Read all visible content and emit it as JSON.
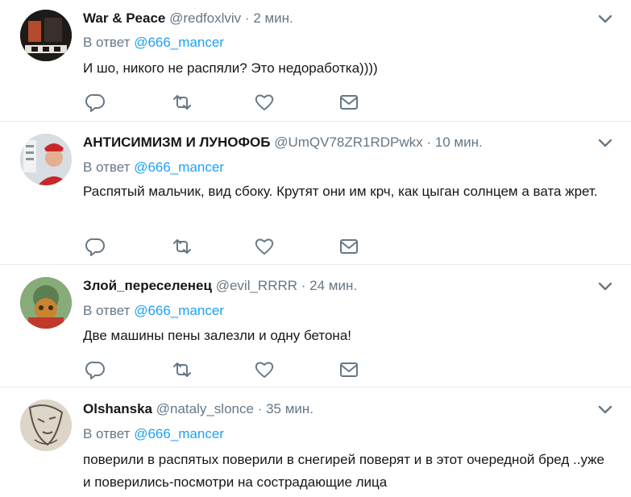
{
  "colors": {
    "text": "#14171a",
    "secondary": "#657786",
    "link": "#1da1f2",
    "divider": "#e6ecf0"
  },
  "icons": [
    "chevron-down-icon",
    "reply-icon",
    "retweet-icon",
    "like-icon",
    "direct-message-icon"
  ],
  "tweets": [
    {
      "name": "War & Peace",
      "handle": "@redfoxlviv",
      "sep": "·",
      "time": "2 мин.",
      "reply_prefix": "В ответ",
      "reply_mention": "@666_mancer",
      "text": "И шо, никого не распяли? Это недоработка))))"
    },
    {
      "name": "АНТИСИМИЗМ И ЛУНОФОБ",
      "handle": "@UmQV78ZR1RDPwkx",
      "sep": "·",
      "time": "10 мин.",
      "reply_prefix": "В ответ",
      "reply_mention": "@666_mancer",
      "text": "Распятый мальчик, вид сбоку. Крутят они им крч, как цыган солнцем а вата жрет."
    },
    {
      "name": "Злой_переселенец",
      "handle": "@evil_RRRR",
      "sep": "·",
      "time": "24 мин.",
      "reply_prefix": "В ответ",
      "reply_mention": "@666_mancer",
      "text": "Две машины пены залезли и одну бетона!"
    },
    {
      "name": "Olshanska",
      "handle": "@nataly_slonce",
      "sep": "·",
      "time": "35 мин.",
      "reply_prefix": "В ответ",
      "reply_mention": "@666_mancer",
      "text": "поверили в распятых поверили в снегирей поверят и в этот очередной бред ..уже и поверились-посмотри на сострадающие лица"
    }
  ]
}
